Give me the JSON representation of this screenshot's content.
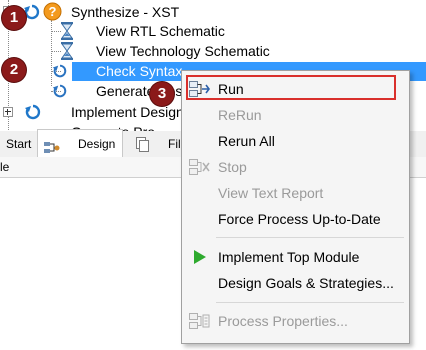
{
  "tree": {
    "items": [
      {
        "label": "Synthesize - XST"
      },
      {
        "label": "View RTL Schematic"
      },
      {
        "label": "View Technology Schematic"
      },
      {
        "label": "Check Syntax"
      },
      {
        "label": "Generate Pos"
      },
      {
        "label": "Implement Design"
      },
      {
        "label": "Generate Pro"
      }
    ]
  },
  "tabs": {
    "start": "Start",
    "design": "Design",
    "files": "Fil"
  },
  "status": {
    "text": "le"
  },
  "annotations": {
    "badge1": "1",
    "badge2": "2",
    "badge3": "3"
  },
  "menu": {
    "run": "Run",
    "rerun": "ReRun",
    "rerun_all": "Rerun All",
    "stop": "Stop",
    "view_text_report": "View Text Report",
    "force_process": "Force Process Up-to-Date",
    "implement_top": "Implement Top Module",
    "design_goals": "Design Goals & Strategies...",
    "process_properties": "Process Properties..."
  },
  "colors": {
    "selection": "#3399ff",
    "highlight_box": "#d9302c",
    "badge": "#8b1a1a",
    "run_arrow": "#2eaa2e"
  }
}
